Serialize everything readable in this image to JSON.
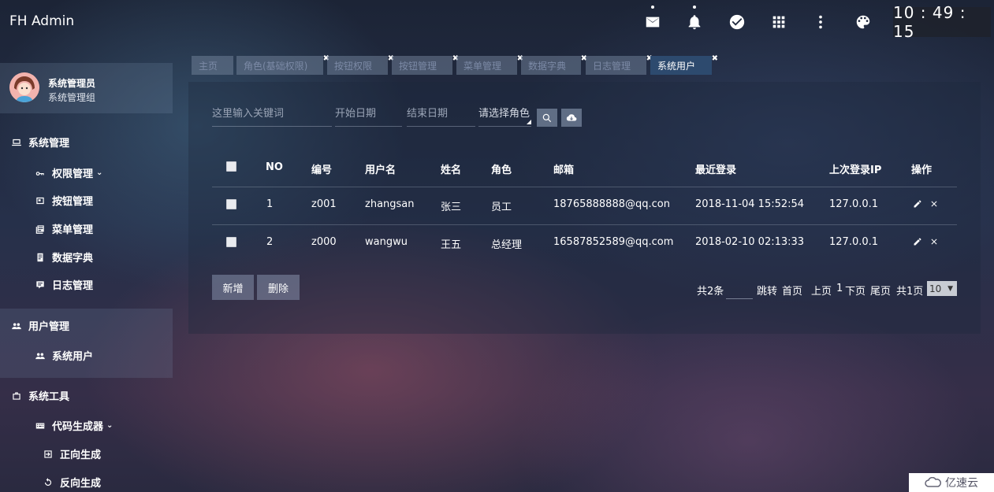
{
  "app": {
    "title": "FH Admin",
    "clock": "10 : 49 : 15"
  },
  "topbar": {
    "icons": [
      "mail-icon",
      "bell-icon",
      "check-circle-icon",
      "apps-grid-icon",
      "more-vertical-icon",
      "palette-icon"
    ]
  },
  "user": {
    "name": "系统管理员",
    "group": "系统管理组"
  },
  "sidebar": {
    "system_management": "系统管理",
    "permission": "权限管理",
    "button_mgmt": "按钮管理",
    "menu_mgmt": "菜单管理",
    "dictionary": "数据字典",
    "log_mgmt": "日志管理",
    "user_management": "用户管理",
    "system_users": "系统用户",
    "system_tools": "系统工具",
    "code_generator": "代码生成器",
    "forward_gen": "正向生成",
    "reverse_gen": "反向生成"
  },
  "tabs": [
    {
      "label": "主页",
      "closable": false
    },
    {
      "label": "角色(基础权限)",
      "closable": true
    },
    {
      "label": "按钮权限",
      "closable": true
    },
    {
      "label": "按钮管理",
      "closable": true
    },
    {
      "label": "菜单管理",
      "closable": true
    },
    {
      "label": "数据字典",
      "closable": true
    },
    {
      "label": "日志管理",
      "closable": true
    },
    {
      "label": "系统用户",
      "closable": true,
      "active": true
    }
  ],
  "search": {
    "keyword_placeholder": "这里输入关键词",
    "start_date_placeholder": "开始日期",
    "end_date_placeholder": "结束日期",
    "role_select": "请选择角色"
  },
  "table": {
    "headers": {
      "no": "NO",
      "code": "编号",
      "username": "用户名",
      "name": "姓名",
      "role": "角色",
      "email": "邮箱",
      "last_login": "最近登录",
      "last_ip": "上次登录IP",
      "actions": "操作"
    },
    "rows": [
      {
        "no": "1",
        "code": "z001",
        "username": "zhangsan",
        "name": "张三",
        "role": "员工",
        "email": "18765888888@qq.con",
        "last_login": "2018-11-04 15:52:54",
        "ip": "127.0.0.1"
      },
      {
        "no": "2",
        "code": "z000",
        "username": "wangwu",
        "name": "王五",
        "role": "总经理",
        "email": "16587852589@qq.com",
        "last_login": "2018-02-10 02:13:33",
        "ip": "127.0.0.1"
      }
    ]
  },
  "buttons": {
    "add": "新增",
    "delete": "删除"
  },
  "pager": {
    "total": "共2条",
    "jump": "跳转",
    "first": "首页",
    "prev": "上页",
    "current": "1",
    "next": "下页",
    "last": "尾页",
    "pages": "共1页",
    "page_size": "10"
  },
  "watermark": "亿速云"
}
